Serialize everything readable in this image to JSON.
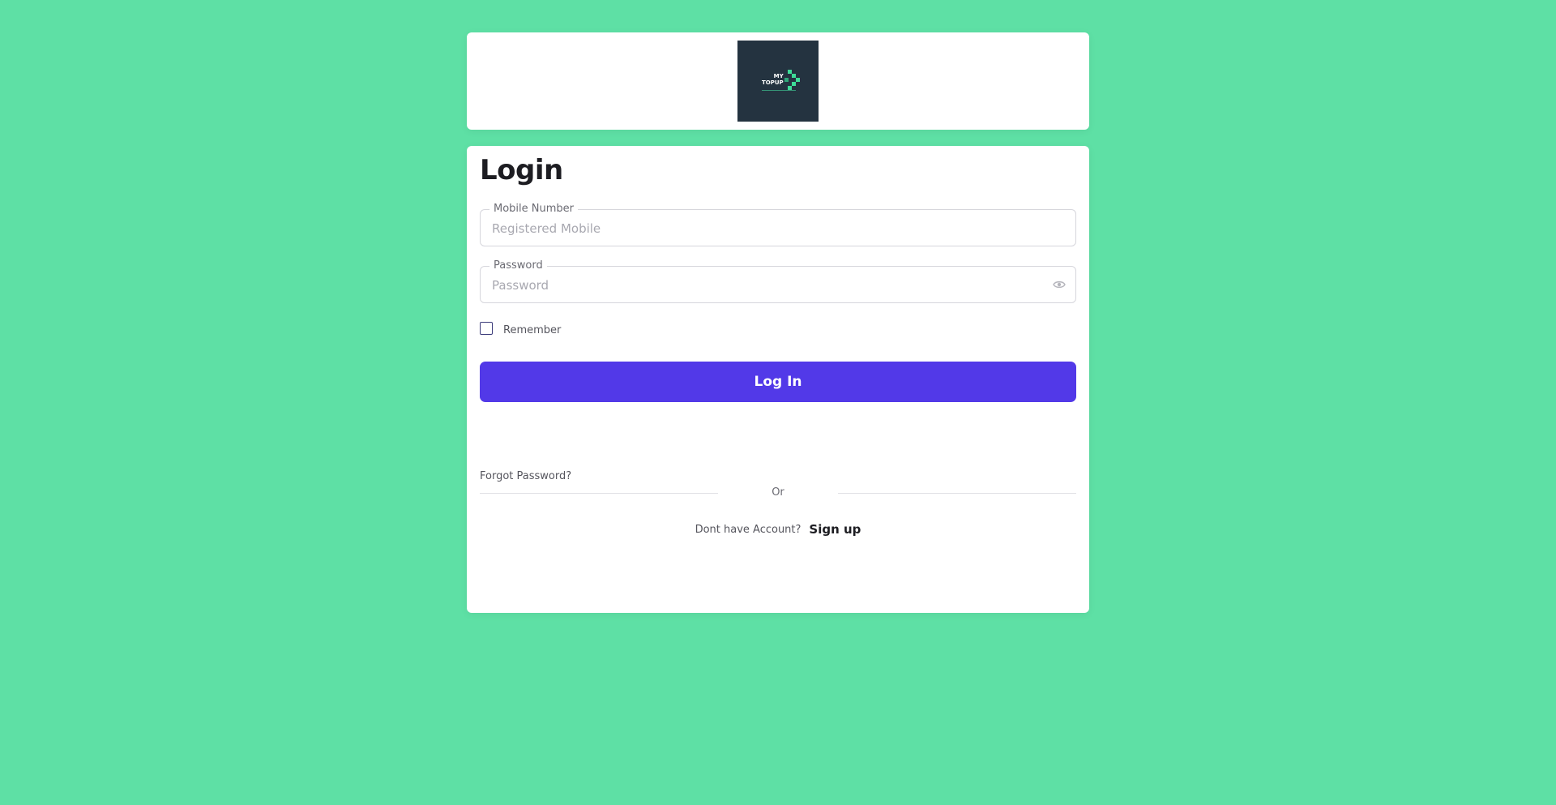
{
  "brand": {
    "logo_line1": "MY",
    "logo_line2": "TOPUP",
    "accent": "#3ddc97",
    "logo_bg": "#243340"
  },
  "login": {
    "title": "Login",
    "mobile": {
      "label": "Mobile Number",
      "placeholder": "Registered Mobile",
      "value": ""
    },
    "password": {
      "label": "Password",
      "placeholder": "Password",
      "value": "",
      "toggle_icon": "eye-icon"
    },
    "remember": {
      "label": "Remember",
      "checked": false
    },
    "submit_label": "Log In",
    "forgot_label": "Forgot Password?",
    "divider_label": "Or",
    "no_account_text": "Dont have Account?",
    "signup_label": "Sign up"
  },
  "colors": {
    "background": "#5ee0a5",
    "primary_button": "#5239e8",
    "card": "#ffffff"
  }
}
